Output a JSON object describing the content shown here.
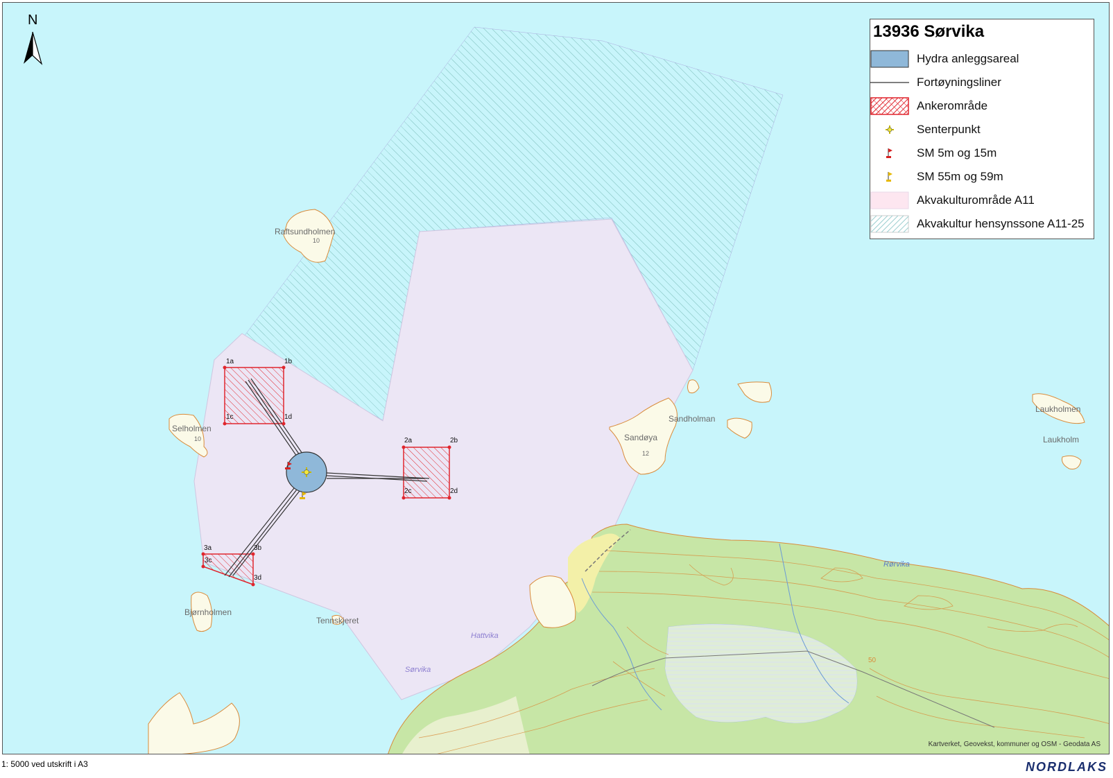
{
  "north_label": "N",
  "legend": {
    "title": "13936 Sørvika",
    "items": [
      {
        "label": "Hydra anleggsareal",
        "symbol": "facility-area-swatch",
        "color": "#8fb8d9"
      },
      {
        "label": "Fortøyningsliner",
        "symbol": "mooring-line-swatch",
        "color": "#333333"
      },
      {
        "label": "Ankerområde",
        "symbol": "anchor-area-swatch",
        "color": "#e0262e"
      },
      {
        "label": "Senterpunkt",
        "symbol": "center-point-icon",
        "color": "#d4c800"
      },
      {
        "label": "SM 5m og 15m",
        "symbol": "red-flag-icon",
        "color": "#d62020"
      },
      {
        "label": "SM 55m og 59m",
        "symbol": "yellow-flag-icon",
        "color": "#e6b800"
      },
      {
        "label": "Akvakulturområde A11",
        "symbol": "aquaculture-area-swatch",
        "color": "#fde6f0"
      },
      {
        "label": "Akvakultur hensynssone A11-25",
        "symbol": "hatched-zone-swatch",
        "color": "#9ccfd0"
      }
    ]
  },
  "places": {
    "raftsundholmen": "Raftsundholmen",
    "raftsundholmen_height": "10",
    "selholmen": "Selholmen",
    "selholmen_height": "10",
    "sandholman": "Sandholman",
    "sandoya": "Sandøya",
    "sandoya_height": "12",
    "laukholmen": "Laukholmen",
    "laukholmen2": "Laukholm",
    "bjornholmen": "Bjørnholmen",
    "tennskjeret": "Tennskjeret",
    "hattvika": "Hattvika",
    "sorvika": "Sørvika",
    "rorvika": "Rørvika",
    "contour_50": "50"
  },
  "anchor_points": {
    "p1a": "1a",
    "p1b": "1b",
    "p1c": "1c",
    "p1d": "1d",
    "p2a": "2a",
    "p2b": "2b",
    "p2c": "2c",
    "p2d": "2d",
    "p3a": "3a",
    "p3b": "3b",
    "p3c": "3c",
    "p3d": "3d"
  },
  "attribution": "Kartverket, Geovekst, kommuner og OSM - Geodata AS",
  "scale_text": "1: 5000 ved utskrift i A3",
  "logo": "NORDLAKS",
  "colors": {
    "sea": "#c8f5fb",
    "aquaculture": "#ece6f5",
    "land_green": "#c7e6a6",
    "contour": "#d98b3a",
    "anchor_red": "#e0262e",
    "facility_blue": "#8fb8d9"
  }
}
